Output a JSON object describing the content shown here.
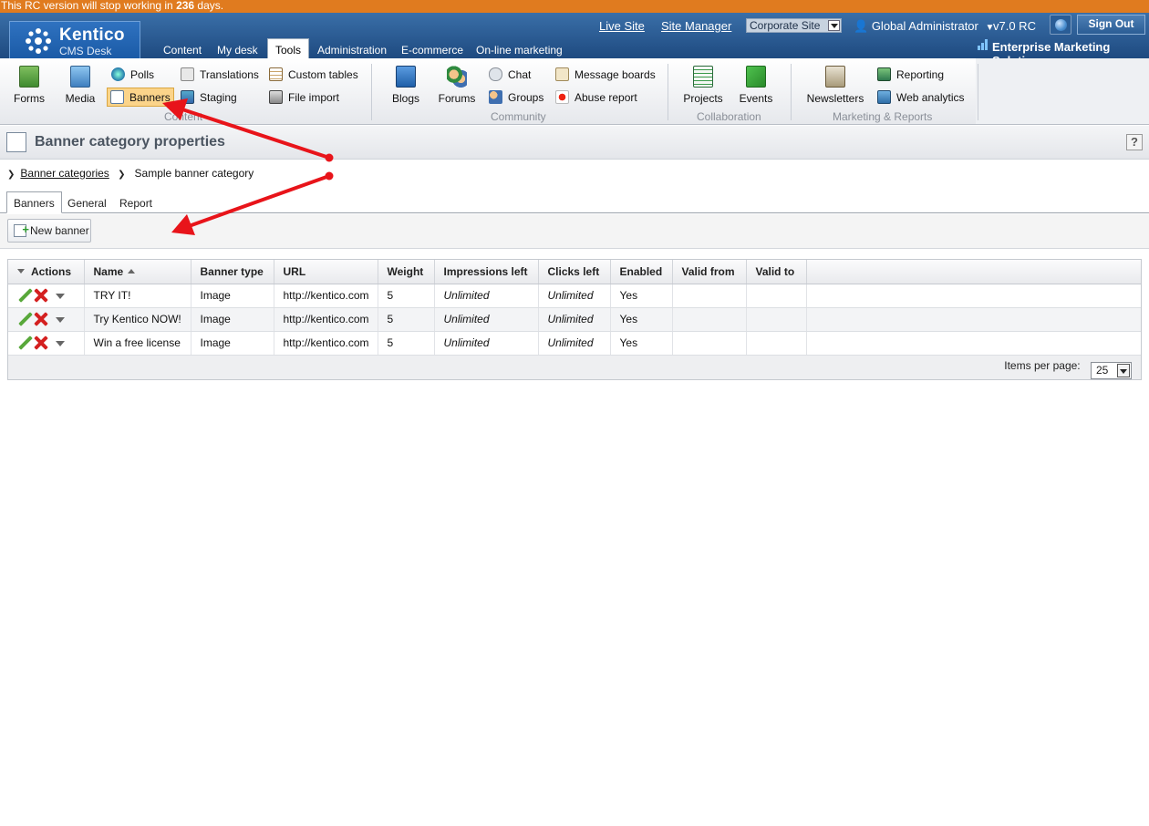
{
  "rc_bar": {
    "prefix": "This RC version will stop working in ",
    "days": "236",
    "suffix": " days."
  },
  "header": {
    "logo_name": "Kentico",
    "logo_sub": "CMS Desk",
    "live_site": "Live Site",
    "site_manager": "Site Manager",
    "site_select": "Corporate Site",
    "user": "Global Administrator",
    "version": "v7.0 RC",
    "sign_out": "Sign Out",
    "edition": "Enterprise Marketing Solution",
    "tabs": [
      "Content",
      "My desk",
      "Tools",
      "Administration",
      "E-commerce",
      "On-line marketing"
    ]
  },
  "ribbon": {
    "content": {
      "label": "Content",
      "forms": "Forms",
      "media": "Media",
      "polls": "Polls",
      "banners": "Banners",
      "translations": "Translations",
      "staging": "Staging",
      "custom_tables": "Custom tables",
      "file_import": "File import"
    },
    "community": {
      "label": "Community",
      "blogs": "Blogs",
      "forums": "Forums",
      "chat": "Chat",
      "groups": "Groups",
      "message_boards": "Message boards",
      "abuse_report": "Abuse report"
    },
    "collaboration": {
      "label": "Collaboration",
      "projects": "Projects",
      "events": "Events"
    },
    "marketing": {
      "label": "Marketing & Reports",
      "newsletters": "Newsletters",
      "reporting": "Reporting",
      "web_analytics": "Web analytics"
    }
  },
  "page": {
    "title": "Banner category properties",
    "help": "?",
    "breadcrumb_link": "Banner categories",
    "breadcrumb_current": "Sample banner category",
    "subtabs": [
      "Banners",
      "General",
      "Report"
    ],
    "new_banner": "New banner"
  },
  "grid": {
    "columns": [
      "Actions",
      "Name",
      "Banner type",
      "URL",
      "Weight",
      "Impressions left",
      "Clicks left",
      "Enabled",
      "Valid from",
      "Valid to"
    ],
    "rows": [
      {
        "name": "TRY IT!",
        "type": "Image",
        "url": "http://kentico.com",
        "weight": "5",
        "impressions": "Unlimited",
        "clicks": "Unlimited",
        "enabled": "Yes"
      },
      {
        "name": "Try Kentico NOW!",
        "type": "Image",
        "url": "http://kentico.com",
        "weight": "5",
        "impressions": "Unlimited",
        "clicks": "Unlimited",
        "enabled": "Yes"
      },
      {
        "name": "Win a free license",
        "type": "Image",
        "url": "http://kentico.com",
        "weight": "5",
        "impressions": "Unlimited",
        "clicks": "Unlimited",
        "enabled": "Yes"
      }
    ],
    "items_per_page_label": "Items per page:",
    "items_per_page": "25"
  },
  "colors": {
    "rc_bar": "#e07b1f",
    "header": "#1e4a80",
    "annotation": "#e8141a",
    "enabled_yes": "#2a9a2a"
  }
}
